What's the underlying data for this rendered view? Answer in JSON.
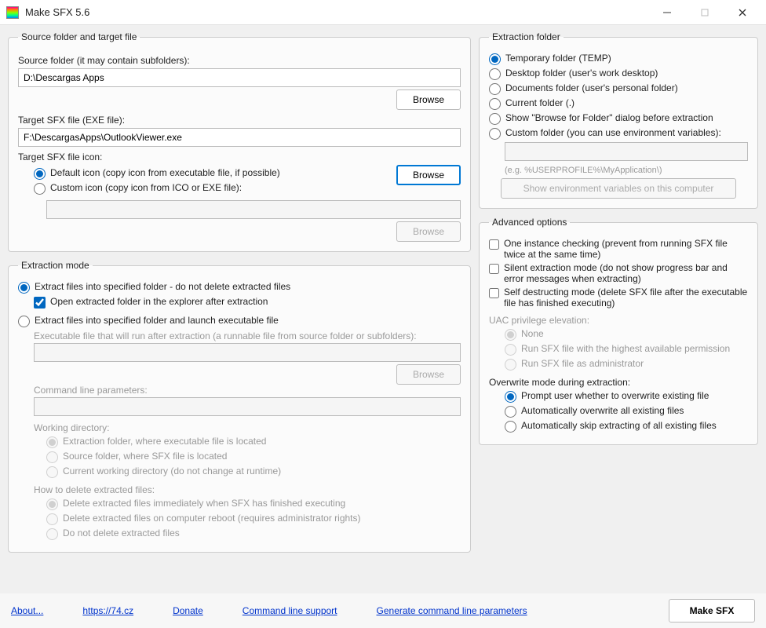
{
  "window": {
    "title": "Make SFX 5.6"
  },
  "source_target": {
    "legend": "Source folder and target file",
    "source_folder_label": "Source folder (it may contain subfolders):",
    "source_folder_value": "D:\\Descargas Apps",
    "browse": "Browse",
    "target_sfx_label": "Target SFX file (EXE file):",
    "target_sfx_value": "F:\\DescargasApps\\OutlookViewer.exe",
    "icon_label": "Target SFX file icon:",
    "icon_default": "Default icon (copy icon from executable file, if possible)",
    "icon_custom": "Custom icon (copy icon from ICO or EXE file):"
  },
  "extraction_mode": {
    "legend": "Extraction mode",
    "opt_extract_only": "Extract files into specified folder - do not delete extracted files",
    "open_folder": "Open extracted folder in the explorer after extraction",
    "opt_extract_launch": "Extract files into specified folder and launch executable file",
    "exe_label": "Executable file that will run after extraction (a runnable file from source folder or subfolders):",
    "cmd_params_label": "Command line parameters:",
    "workdir_label": "Working directory:",
    "workdir_extract": "Extraction folder, where executable file is located",
    "workdir_source": "Source folder, where SFX file is located",
    "workdir_current": "Current working directory (do not change at runtime)",
    "delete_label": "How to delete extracted files:",
    "delete_immediate": "Delete extracted files immediately when SFX has finished executing",
    "delete_reboot": "Delete extracted files on computer reboot (requires administrator rights)",
    "delete_no": "Do not delete extracted files"
  },
  "extraction_folder": {
    "legend": "Extraction folder",
    "temp": "Temporary folder (TEMP)",
    "desktop": "Desktop folder (user's work desktop)",
    "documents": "Documents folder (user's personal folder)",
    "current": "Current folder (.)",
    "browse_dialog": "Show \"Browse for Folder\" dialog before extraction",
    "custom": "Custom folder (you can use environment variables):",
    "hint": "(e.g. %USERPROFILE%\\MyApplication\\)",
    "env_btn": "Show environment variables on this computer"
  },
  "advanced": {
    "legend": "Advanced options",
    "one_instance": "One instance checking (prevent from running SFX file twice at the same time)",
    "silent": "Silent extraction mode (do not show progress bar and error messages when extracting)",
    "self_destruct": "Self destructing mode (delete SFX file after the executable file has finished executing)",
    "uac_label": "UAC privilege elevation:",
    "uac_none": "None",
    "uac_highest": "Run SFX file with the highest available permission",
    "uac_admin": "Run SFX file as administrator",
    "overwrite_label": "Overwrite mode during extraction:",
    "overwrite_prompt": "Prompt user whether to overwrite existing file",
    "overwrite_auto": "Automatically overwrite all existing files",
    "overwrite_skip": "Automatically skip extracting of all existing files"
  },
  "footer": {
    "about": "About...",
    "url": "https://74.cz",
    "donate": "Donate",
    "cli": "Command line support",
    "gen": "Generate command line parameters",
    "make": "Make SFX"
  }
}
